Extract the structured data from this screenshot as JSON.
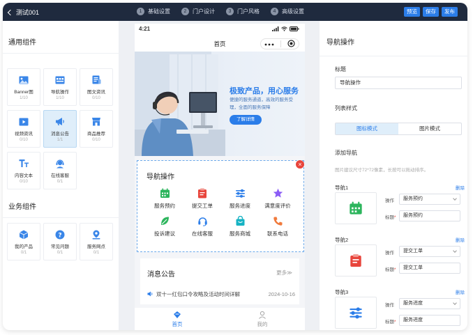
{
  "topbar": {
    "title": "测试001",
    "steps": [
      {
        "num": "1",
        "label": "基础设置"
      },
      {
        "num": "2",
        "label": "门户设计"
      },
      {
        "num": "3",
        "label": "门户风格"
      },
      {
        "num": "4",
        "label": "高级设置"
      }
    ],
    "actions": {
      "preview": "预览",
      "save": "保存",
      "publish": "发布"
    }
  },
  "left": {
    "general_title": "通用组件",
    "general": [
      {
        "label": "Banner图",
        "count": "1/10",
        "icon": "image-icon"
      },
      {
        "label": "导航操作",
        "count": "1/10",
        "icon": "grid-nav-icon"
      },
      {
        "label": "图文资讯",
        "count": "0/10",
        "icon": "article-icon"
      },
      {
        "label": "视频资讯",
        "count": "0/10",
        "icon": "video-icon"
      },
      {
        "label": "消息公告",
        "count": "1/1",
        "icon": "megaphone-icon"
      },
      {
        "label": "商品推荐",
        "count": "0/10",
        "icon": "shop-icon"
      },
      {
        "label": "内容文本",
        "count": "0/10",
        "icon": "text-icon"
      },
      {
        "label": "在线客服",
        "count": "0/1",
        "icon": "customer-service-icon"
      }
    ],
    "business_title": "业务组件",
    "business": [
      {
        "label": "我的产品",
        "count": "0/1",
        "icon": "cube-icon"
      },
      {
        "label": "常见问题",
        "count": "0/1",
        "icon": "question-icon"
      },
      {
        "label": "服务网点",
        "count": "0/1",
        "icon": "location-icon"
      }
    ]
  },
  "phone": {
    "time": "4:21",
    "nav_title": "首页",
    "banner": {
      "title": "极致产品，用心服务",
      "subtitle": "便捷的服务通道，高效的服务受理，全面的服务保障",
      "button": "了解详情"
    },
    "nav_section": {
      "title": "导航操作",
      "items": [
        {
          "label": "服务预约",
          "color": "#2db55d"
        },
        {
          "label": "提交工单",
          "color": "#e8453c"
        },
        {
          "label": "服务进度",
          "color": "#2b7de9"
        },
        {
          "label": "满意度评价",
          "color": "#8b5cf6"
        },
        {
          "label": "投诉建议",
          "color": "#2db55d"
        },
        {
          "label": "在线客服",
          "color": "#2b7de9"
        },
        {
          "label": "服务商城",
          "color": "#17b3c4"
        },
        {
          "label": "联系电话",
          "color": "#f07a3c"
        }
      ]
    },
    "notice": {
      "title": "消息公告",
      "more": "更多≫",
      "item_title": "双十一红包口令攻略及活动时间详解",
      "item_date": "2024-10-16"
    },
    "tabs": {
      "home": "首页",
      "mine": "我的"
    }
  },
  "right": {
    "header": "导航操作",
    "title_label": "标题",
    "title_value": "导航操作",
    "list_style_label": "列表样式",
    "style_options": [
      "图标模式",
      "图片模式"
    ],
    "add_nav_label": "添加导航",
    "hint": "图片建议尺寸72*72像素，长按可以拖动排序。",
    "op_label": "操作",
    "name_label": "标题",
    "delete_label": "删除",
    "navs": [
      {
        "label": "导航1",
        "operation": "服务预约",
        "title": "服务预约"
      },
      {
        "label": "导航2",
        "operation": "提交工单",
        "title": "提交工单"
      },
      {
        "label": "导航3",
        "operation": "服务进度",
        "title": "服务进度"
      }
    ]
  },
  "colors": {
    "accent": "#2b7de9",
    "topbar": "#1f2a3e",
    "danger": "#e8453c",
    "active_bg": "#dfeefa"
  }
}
